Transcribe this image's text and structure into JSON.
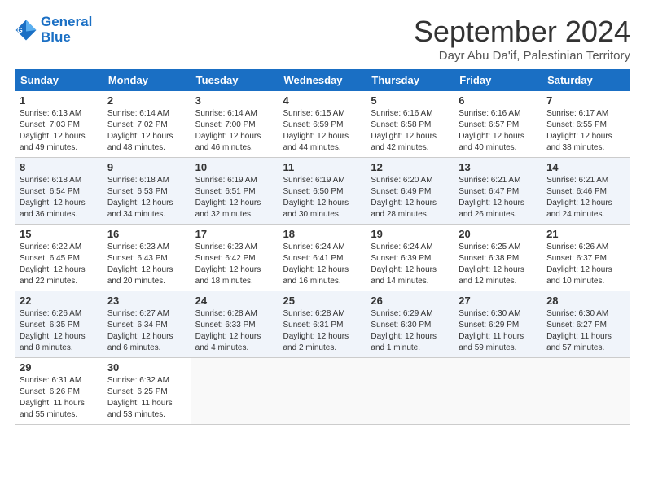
{
  "header": {
    "logo_line1": "General",
    "logo_line2": "Blue",
    "month": "September 2024",
    "location": "Dayr Abu Da'if, Palestinian Territory"
  },
  "columns": [
    "Sunday",
    "Monday",
    "Tuesday",
    "Wednesday",
    "Thursday",
    "Friday",
    "Saturday"
  ],
  "weeks": [
    [
      {
        "day": "1",
        "sunrise": "6:13 AM",
        "sunset": "7:03 PM",
        "daylight": "12 hours and 49 minutes."
      },
      {
        "day": "2",
        "sunrise": "6:14 AM",
        "sunset": "7:02 PM",
        "daylight": "12 hours and 48 minutes."
      },
      {
        "day": "3",
        "sunrise": "6:14 AM",
        "sunset": "7:00 PM",
        "daylight": "12 hours and 46 minutes."
      },
      {
        "day": "4",
        "sunrise": "6:15 AM",
        "sunset": "6:59 PM",
        "daylight": "12 hours and 44 minutes."
      },
      {
        "day": "5",
        "sunrise": "6:16 AM",
        "sunset": "6:58 PM",
        "daylight": "12 hours and 42 minutes."
      },
      {
        "day": "6",
        "sunrise": "6:16 AM",
        "sunset": "6:57 PM",
        "daylight": "12 hours and 40 minutes."
      },
      {
        "day": "7",
        "sunrise": "6:17 AM",
        "sunset": "6:55 PM",
        "daylight": "12 hours and 38 minutes."
      }
    ],
    [
      {
        "day": "8",
        "sunrise": "6:18 AM",
        "sunset": "6:54 PM",
        "daylight": "12 hours and 36 minutes."
      },
      {
        "day": "9",
        "sunrise": "6:18 AM",
        "sunset": "6:53 PM",
        "daylight": "12 hours and 34 minutes."
      },
      {
        "day": "10",
        "sunrise": "6:19 AM",
        "sunset": "6:51 PM",
        "daylight": "12 hours and 32 minutes."
      },
      {
        "day": "11",
        "sunrise": "6:19 AM",
        "sunset": "6:50 PM",
        "daylight": "12 hours and 30 minutes."
      },
      {
        "day": "12",
        "sunrise": "6:20 AM",
        "sunset": "6:49 PM",
        "daylight": "12 hours and 28 minutes."
      },
      {
        "day": "13",
        "sunrise": "6:21 AM",
        "sunset": "6:47 PM",
        "daylight": "12 hours and 26 minutes."
      },
      {
        "day": "14",
        "sunrise": "6:21 AM",
        "sunset": "6:46 PM",
        "daylight": "12 hours and 24 minutes."
      }
    ],
    [
      {
        "day": "15",
        "sunrise": "6:22 AM",
        "sunset": "6:45 PM",
        "daylight": "12 hours and 22 minutes."
      },
      {
        "day": "16",
        "sunrise": "6:23 AM",
        "sunset": "6:43 PM",
        "daylight": "12 hours and 20 minutes."
      },
      {
        "day": "17",
        "sunrise": "6:23 AM",
        "sunset": "6:42 PM",
        "daylight": "12 hours and 18 minutes."
      },
      {
        "day": "18",
        "sunrise": "6:24 AM",
        "sunset": "6:41 PM",
        "daylight": "12 hours and 16 minutes."
      },
      {
        "day": "19",
        "sunrise": "6:24 AM",
        "sunset": "6:39 PM",
        "daylight": "12 hours and 14 minutes."
      },
      {
        "day": "20",
        "sunrise": "6:25 AM",
        "sunset": "6:38 PM",
        "daylight": "12 hours and 12 minutes."
      },
      {
        "day": "21",
        "sunrise": "6:26 AM",
        "sunset": "6:37 PM",
        "daylight": "12 hours and 10 minutes."
      }
    ],
    [
      {
        "day": "22",
        "sunrise": "6:26 AM",
        "sunset": "6:35 PM",
        "daylight": "12 hours and 8 minutes."
      },
      {
        "day": "23",
        "sunrise": "6:27 AM",
        "sunset": "6:34 PM",
        "daylight": "12 hours and 6 minutes."
      },
      {
        "day": "24",
        "sunrise": "6:28 AM",
        "sunset": "6:33 PM",
        "daylight": "12 hours and 4 minutes."
      },
      {
        "day": "25",
        "sunrise": "6:28 AM",
        "sunset": "6:31 PM",
        "daylight": "12 hours and 2 minutes."
      },
      {
        "day": "26",
        "sunrise": "6:29 AM",
        "sunset": "6:30 PM",
        "daylight": "12 hours and 1 minute."
      },
      {
        "day": "27",
        "sunrise": "6:30 AM",
        "sunset": "6:29 PM",
        "daylight": "11 hours and 59 minutes."
      },
      {
        "day": "28",
        "sunrise": "6:30 AM",
        "sunset": "6:27 PM",
        "daylight": "11 hours and 57 minutes."
      }
    ],
    [
      {
        "day": "29",
        "sunrise": "6:31 AM",
        "sunset": "6:26 PM",
        "daylight": "11 hours and 55 minutes."
      },
      {
        "day": "30",
        "sunrise": "6:32 AM",
        "sunset": "6:25 PM",
        "daylight": "11 hours and 53 minutes."
      },
      null,
      null,
      null,
      null,
      null
    ]
  ]
}
